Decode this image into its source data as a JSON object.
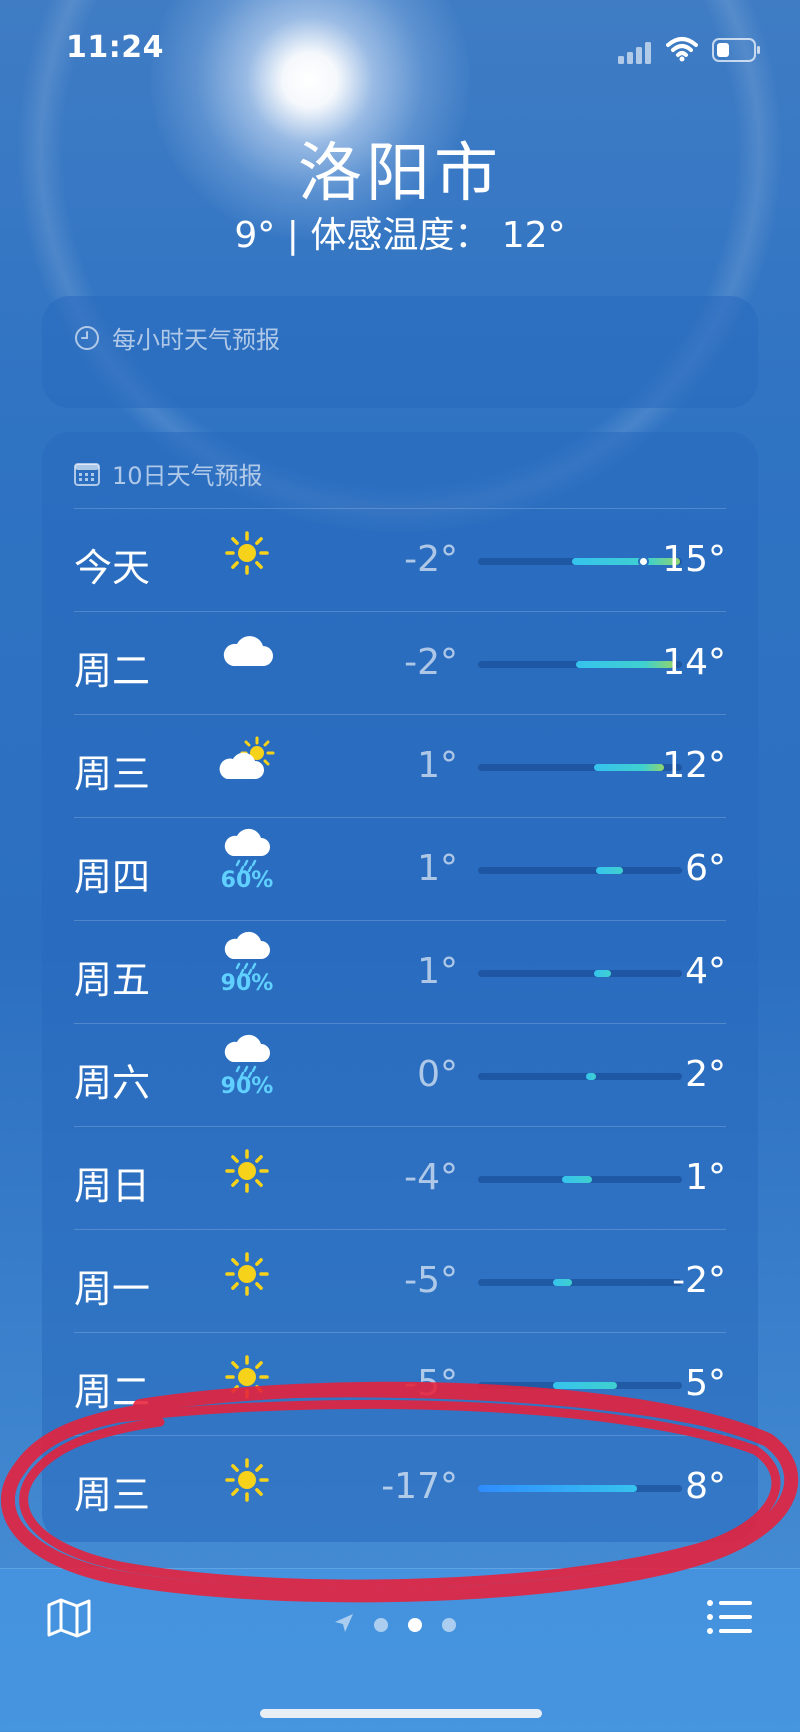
{
  "status": {
    "time": "11:24"
  },
  "location": {
    "city": "洛阳市",
    "summary": "9° | 体感温度： 12°"
  },
  "hourly_card": {
    "title": "每小时天气预报"
  },
  "daily_card": {
    "title": "10日天气预报",
    "days": [
      {
        "day": "今天",
        "icon": "sun-icon",
        "precip": "",
        "low": "-2°",
        "high": "15°",
        "range": [
          0.46,
          0.99
        ],
        "current_fraction": 0.81
      },
      {
        "day": "周二",
        "icon": "cloud-icon",
        "precip": "",
        "low": "-2°",
        "high": "14°",
        "range": [
          0.48,
          0.96
        ]
      },
      {
        "day": "周三",
        "icon": "partly-cloudy-icon",
        "precip": "",
        "low": "1°",
        "high": "12°",
        "range": [
          0.57,
          0.91
        ]
      },
      {
        "day": "周四",
        "icon": "rain-icon",
        "precip": "60%",
        "low": "1°",
        "high": "6°",
        "range": [
          0.58,
          0.71
        ]
      },
      {
        "day": "周五",
        "icon": "rain-icon",
        "precip": "90%",
        "low": "1°",
        "high": "4°",
        "range": [
          0.57,
          0.65
        ]
      },
      {
        "day": "周六",
        "icon": "rain-icon",
        "precip": "90%",
        "low": "0°",
        "high": "2°",
        "range": [
          0.53,
          0.58
        ]
      },
      {
        "day": "周日",
        "icon": "sun-icon",
        "precip": "",
        "low": "-4°",
        "high": "1°",
        "range": [
          0.41,
          0.56
        ]
      },
      {
        "day": "周一",
        "icon": "sun-icon",
        "precip": "",
        "low": "-5°",
        "high": "-2°",
        "range": [
          0.37,
          0.46
        ]
      },
      {
        "day": "周二",
        "icon": "sun-icon",
        "precip": "",
        "low": "-5°",
        "high": "5°",
        "range": [
          0.37,
          0.68
        ]
      },
      {
        "day": "周三",
        "icon": "sun-icon",
        "precip": "",
        "low": "-17°",
        "high": "8°",
        "range": [
          0.0,
          0.78
        ]
      }
    ]
  },
  "colors": {
    "bar_cold": "#2f8cff",
    "bar_cool": "#36c3ee",
    "bar_mild": "#3fd0cf",
    "bar_warm": "#8fd56e",
    "sun": "#f7d21a",
    "annotation": "#e8203a"
  },
  "annotation": {
    "shape": "red hand-drawn ellipse",
    "target_row": 9
  }
}
